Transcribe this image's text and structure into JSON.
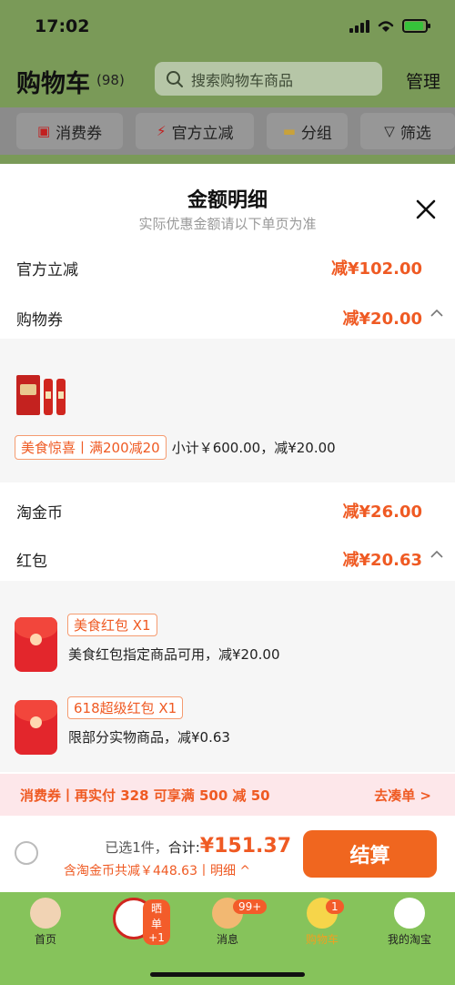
{
  "status": {
    "time": "17:02"
  },
  "header": {
    "title": "购物车",
    "count": "(98)",
    "search_placeholder": "搜索购物车商品",
    "manage": "管理"
  },
  "filters": [
    {
      "label": "消费券",
      "icon": "ticket-icon"
    },
    {
      "label": "官方立减",
      "icon": "lightning-icon"
    },
    {
      "label": "分组",
      "icon": "folder-icon"
    },
    {
      "label": "筛选",
      "icon": "filter-icon"
    }
  ],
  "sheet": {
    "title": "金额明细",
    "subtitle": "实际优惠金额请以下单页为准",
    "rows": {
      "official_discount": {
        "label": "官方立减",
        "value": "减¥102.00"
      },
      "coupon": {
        "label": "购物券",
        "value": "减¥20.00"
      },
      "taojinbi": {
        "label": "淘金币",
        "value": "减¥26.00"
      },
      "hongbao": {
        "label": "红包",
        "value": "减¥20.63"
      }
    },
    "coupon_detail": {
      "tag": "美食惊喜丨满200减20",
      "summary": "小计￥600.00，减¥20.00"
    },
    "hongbao_items": [
      {
        "tag": "美食红包 X1",
        "desc": "美食红包指定商品可用，减¥20.00"
      },
      {
        "tag": "618超级红包 X1",
        "desc": "限部分实物商品，减¥0.63"
      }
    ]
  },
  "voucher_bar": {
    "left": "消费券丨再实付 328 可享满 500 减 50",
    "right": "去凑单 >"
  },
  "checkout": {
    "selected": "已选1件，",
    "total_label": "合计:",
    "total": "¥151.37",
    "discount": "含淘金币共减￥448.63丨明细 ^",
    "pay": "结算"
  },
  "tabbar": [
    {
      "label": "首页",
      "icon": "home-icon"
    },
    {
      "label": "",
      "icon": "product-icon",
      "badge": "晒单+1"
    },
    {
      "label": "消息",
      "icon": "message-icon",
      "badge": "99+"
    },
    {
      "label": "购物车",
      "icon": "cart-icon",
      "badge": "1"
    },
    {
      "label": "我的淘宝",
      "icon": "profile-icon"
    }
  ],
  "colors": {
    "accent": "#ef5a23",
    "pay_button": "#f0661f",
    "voucher_bg": "#fde7ea",
    "tabbar_bg": "#86c35b"
  }
}
